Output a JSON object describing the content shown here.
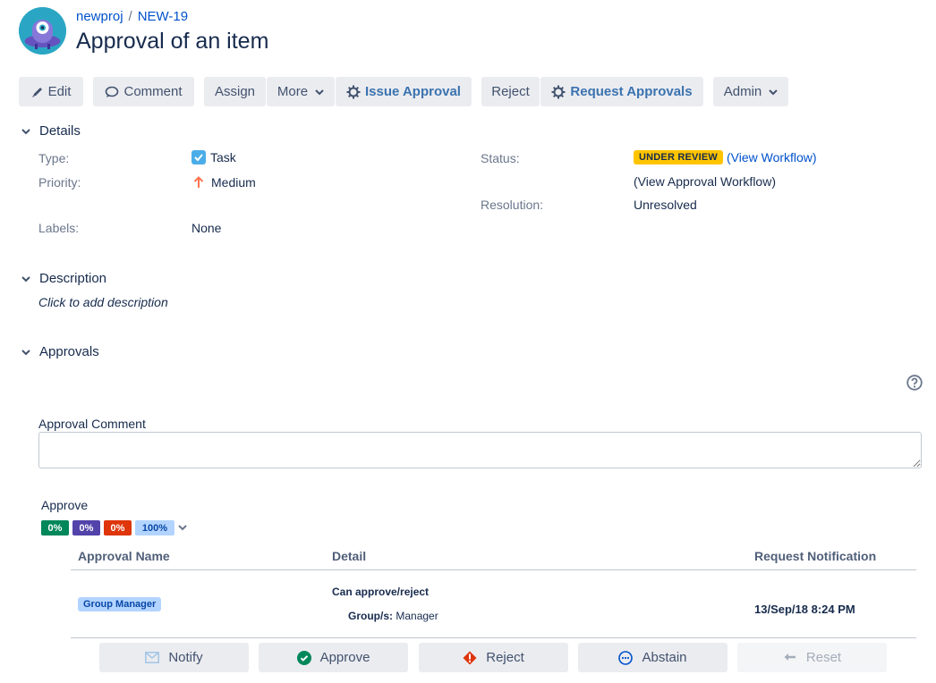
{
  "header": {
    "project": "newproj",
    "separator": "/",
    "issue_key": "NEW-19",
    "title": "Approval of an item"
  },
  "toolbar": {
    "edit": "Edit",
    "comment": "Comment",
    "assign": "Assign",
    "more": "More",
    "issue_approval": "Issue Approval",
    "reject": "Reject",
    "request_approvals": "Request Approvals",
    "admin": "Admin"
  },
  "details": {
    "heading": "Details",
    "type_label": "Type:",
    "type_value": "Task",
    "priority_label": "Priority:",
    "priority_value": "Medium",
    "labels_label": "Labels:",
    "labels_value": "None",
    "status_label": "Status:",
    "status_value": "UNDER REVIEW",
    "view_workflow": "(View Workflow)",
    "view_approval_workflow": "(View Approval Workflow)",
    "resolution_label": "Resolution:",
    "resolution_value": "Unresolved"
  },
  "description": {
    "heading": "Description",
    "placeholder": "Click to add description"
  },
  "approvals": {
    "heading": "Approvals",
    "comment_label": "Approval Comment",
    "approve_label": "Approve",
    "percentages": [
      {
        "value": "0%",
        "color": "#00875a"
      },
      {
        "value": "0%",
        "color": "#5243aa"
      },
      {
        "value": "0%",
        "color": "#de350b"
      },
      {
        "value": "100%",
        "color": "#b3d4ff"
      }
    ],
    "table": {
      "headers": [
        "Approval Name",
        "Detail",
        "Request Notification"
      ],
      "row": {
        "name": "Group Manager",
        "detail_title": "Can approve/reject",
        "group_label": "Group/s:",
        "group_value": "Manager",
        "notification": "13/Sep/18 8:24 PM"
      }
    },
    "actions": {
      "notify": "Notify",
      "approve": "Approve",
      "reject": "Reject",
      "abstain": "Abstain",
      "reset": "Reset"
    }
  },
  "colors": {
    "link": "#0052cc",
    "status_lozenge": "#ffc400",
    "button_bg": "#ebecf0"
  }
}
